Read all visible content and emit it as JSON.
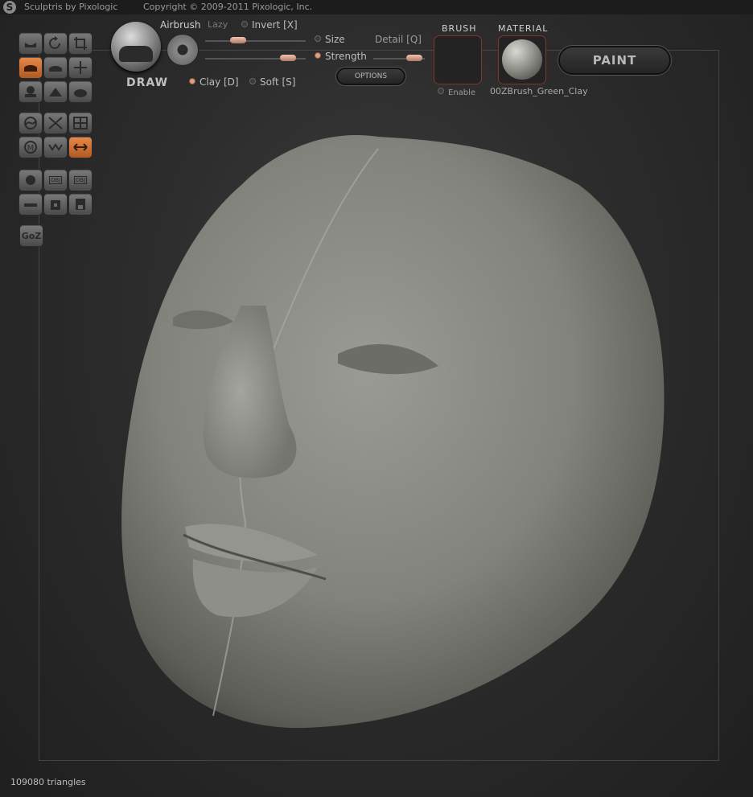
{
  "titlebar": {
    "app": "Sculptris by Pixologic",
    "copyright": "Copyright © 2009-2011 Pixologic, Inc."
  },
  "toolbar": {
    "tool_name": "DRAW",
    "airbrush": "Airbrush",
    "lazy": "Lazy",
    "invert": "Invert [X]",
    "size": "Size",
    "detail": "Detail [Q]",
    "strength": "Strength",
    "clay": "Clay [D]",
    "soft": "Soft [S]",
    "options": "OPTIONS",
    "size_value": 0.33,
    "strength_value": 0.82,
    "detail_value": 0.8
  },
  "brush": {
    "heading": "BRUSH",
    "enable": "Enable"
  },
  "material": {
    "heading": "MATERIAL",
    "name": "00ZBrush_Green_Clay"
  },
  "paint_button": "PAINT",
  "left_tools": {
    "goz": "GoZ",
    "obj1": "OBJ",
    "obj2": "OBJ"
  },
  "status": {
    "triangles": "109080 triangles"
  },
  "colors": {
    "accent": "#d97a3a",
    "mesh": "#8c8d86"
  }
}
